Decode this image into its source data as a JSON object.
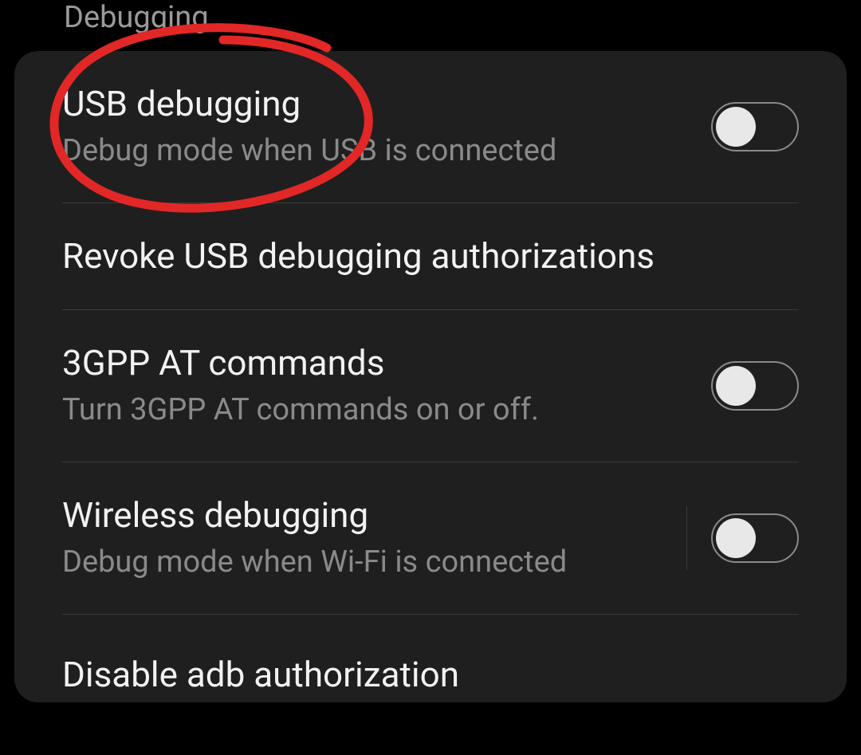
{
  "section_header": "Debugging",
  "items": [
    {
      "title": "USB debugging",
      "subtitle": "Debug mode when USB is connected"
    },
    {
      "title": "Revoke USB debugging authorizations"
    },
    {
      "title": "3GPP AT commands",
      "subtitle": "Turn 3GPP AT commands on or off."
    },
    {
      "title": "Wireless debugging",
      "subtitle": "Debug mode when Wi-Fi is connected"
    },
    {
      "title": "Disable adb authorization"
    }
  ]
}
